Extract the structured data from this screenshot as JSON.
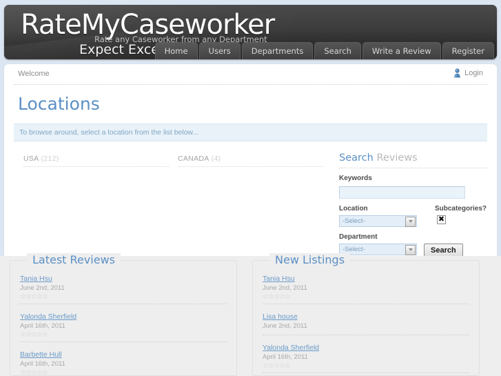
{
  "site": {
    "logo": "RateMyCaseworker",
    "tagline": "Rate any Caseworker from any Department",
    "slogan": "Expect Excellence",
    "accent_color": "#5b90c4",
    "header_bg": "#3a3a3a",
    "page_bg": "#dce6f2"
  },
  "nav": {
    "items": [
      {
        "label": "Home"
      },
      {
        "label": "Users"
      },
      {
        "label": "Departments"
      },
      {
        "label": "Search"
      },
      {
        "label": "Write a Review"
      },
      {
        "label": "Register"
      }
    ]
  },
  "topbar": {
    "welcome": "Welcome",
    "login_label": "Login",
    "login_icon": "user-icon"
  },
  "page": {
    "title": "Locations",
    "info_text": "To browse around, select a location from the list below..."
  },
  "locations": [
    {
      "name": "USA",
      "count": "(212)"
    },
    {
      "name": "CANADA",
      "count": "(4)"
    }
  ],
  "search_widget": {
    "heading_main": "Search",
    "heading_sub": "Reviews",
    "keywords_label": "Keywords",
    "keywords_value": "",
    "keywords_placeholder": "",
    "location_label": "Location",
    "location_value": "-Select-",
    "department_label": "Department",
    "department_value": "-Select-",
    "subcategories_label": "Subcategories?",
    "subcategories_checked": "✖",
    "search_button": "Search"
  },
  "footer_panels": [
    {
      "title": "Latest Reviews",
      "entries": [
        {
          "name": "Tania Hsu",
          "date": "June 2nd, 2011",
          "stars": 5
        },
        {
          "name": "Yalonda Sherfield",
          "date": "April 16th, 2011",
          "stars": 5
        },
        {
          "name": "Barbette Hull",
          "date": "April 16th, 2011",
          "stars": 5
        }
      ]
    },
    {
      "title": "New Listings",
      "entries": [
        {
          "name": "Tania Hsu",
          "date": "June 2nd, 2011",
          "stars": 5
        },
        {
          "name": "Lisa house",
          "date": "June 2nd, 2011",
          "stars": 0
        },
        {
          "name": "Yalonda Sherfield",
          "date": "April 16th, 2011",
          "stars": 5
        }
      ]
    }
  ]
}
